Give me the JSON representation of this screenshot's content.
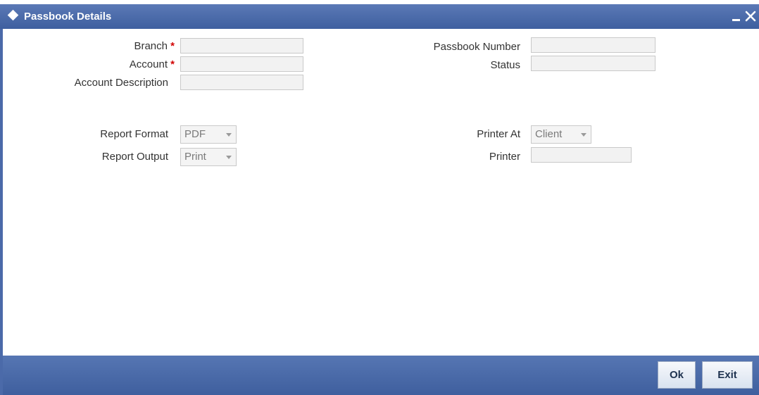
{
  "window": {
    "title": "Passbook Details",
    "minimize_icon": "minimize-icon",
    "close_icon": "close-icon",
    "accent_color": "#4b6aa9"
  },
  "form": {
    "branch_label": "Branch",
    "account_label": "Account",
    "account_description_label": "Account Description",
    "passbook_number_label": "Passbook Number",
    "status_label": "Status",
    "required_marker": "*",
    "branch_value": "",
    "account_value": "",
    "account_description_value": "",
    "passbook_number_value": "",
    "status_value": ""
  },
  "report": {
    "report_format_label": "Report Format",
    "report_format_value": "PDF",
    "report_output_label": "Report Output",
    "report_output_value": "Print",
    "printer_at_label": "Printer At",
    "printer_at_value": "Client",
    "printer_label": "Printer",
    "printer_value": ""
  },
  "footer": {
    "ok_label": "Ok",
    "exit_label": "Exit"
  }
}
